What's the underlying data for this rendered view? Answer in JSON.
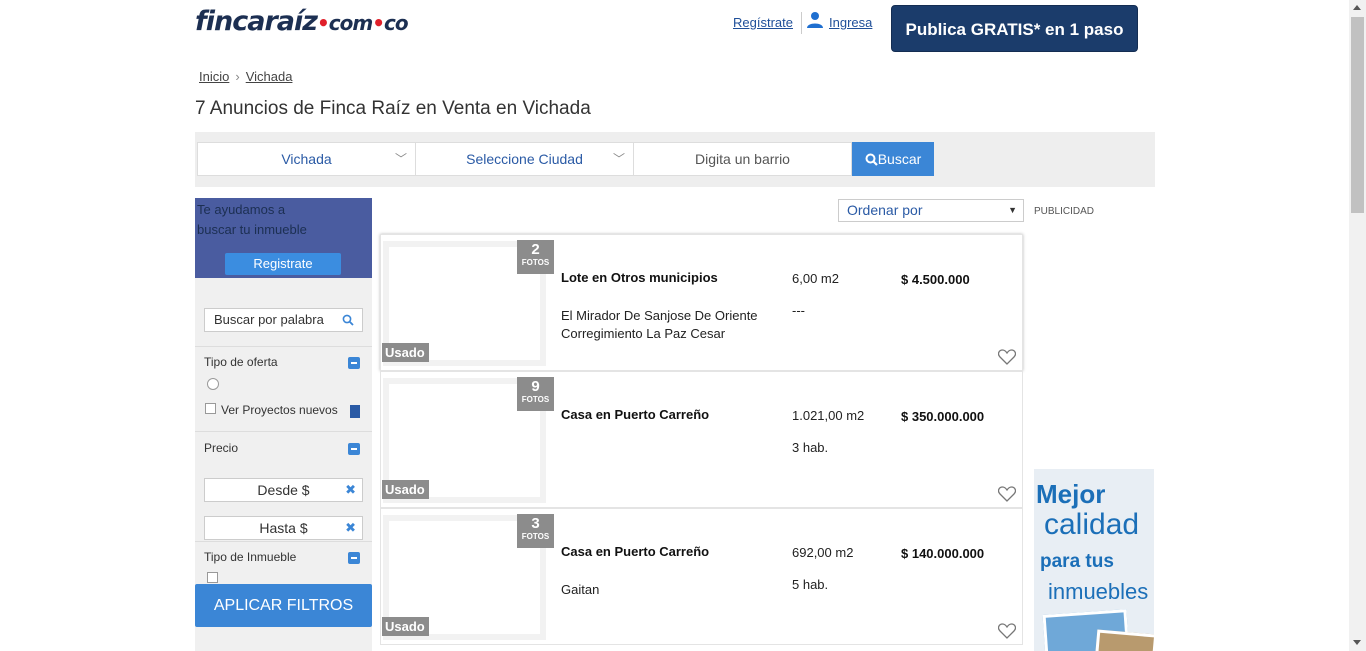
{
  "header": {
    "logo_main": "fincaraíz",
    "logo_dom_1": "com",
    "logo_dom_2": "co",
    "register_link": "Regístrate",
    "login_link": "Ingresa",
    "publish_button": "Publica GRATIS* en 1 paso"
  },
  "breadcrumb": {
    "home": "Inicio",
    "current": "Vichada",
    "separator": "›"
  },
  "page_title": "7 Anuncios de Finca Raíz en Venta en Vichada",
  "search": {
    "department": "Vichada",
    "city": "Seleccione Ciudad",
    "barrio_placeholder": "Digita un barrio",
    "button": "Buscar"
  },
  "sidebar": {
    "help_line1": "Te ayudamos a",
    "help_line2": "buscar tu inmueble",
    "register_button": "Registrate",
    "word_search_placeholder": "Buscar por palabra",
    "offer_title": "Tipo de oferta",
    "projects_label": "Ver Proyectos nuevos",
    "price_title": "Precio",
    "price_from": "Desde $",
    "price_to": "Hasta $",
    "property_type_title": "Tipo de Inmueble",
    "apply_button": "APLICAR FILTROS"
  },
  "results": {
    "order_by": "Ordenar por",
    "ad_label": "PUBLICIDAD",
    "fotos_label": "FOTOS",
    "condition_label": "Usado",
    "listings": [
      {
        "photos": "2",
        "title": "Lote en Otros municipios",
        "address": "El Mirador De Sanjose De Oriente Corregimiento La Paz Cesar",
        "area": "6,00 m2",
        "extra": "---",
        "price": "$ 4.500.000"
      },
      {
        "photos": "9",
        "title": "Casa en Puerto Carreño",
        "address": "",
        "area": "1.021,00 m2",
        "extra": "3 hab.",
        "price": "$ 350.000.000"
      },
      {
        "photos": "3",
        "title": "Casa en Puerto Carreño",
        "address": "Gaitan",
        "area": "692,00 m2",
        "extra": "5 hab.",
        "price": "$ 140.000.000"
      }
    ]
  },
  "ad": {
    "line1": "Mejor",
    "line2": "calidad",
    "line3": "para tus",
    "line4": "inmuebles"
  },
  "colors": {
    "brand_navy": "#1b3c6b",
    "accent_blue": "#3b86d6",
    "logo_red": "#e0202a"
  }
}
